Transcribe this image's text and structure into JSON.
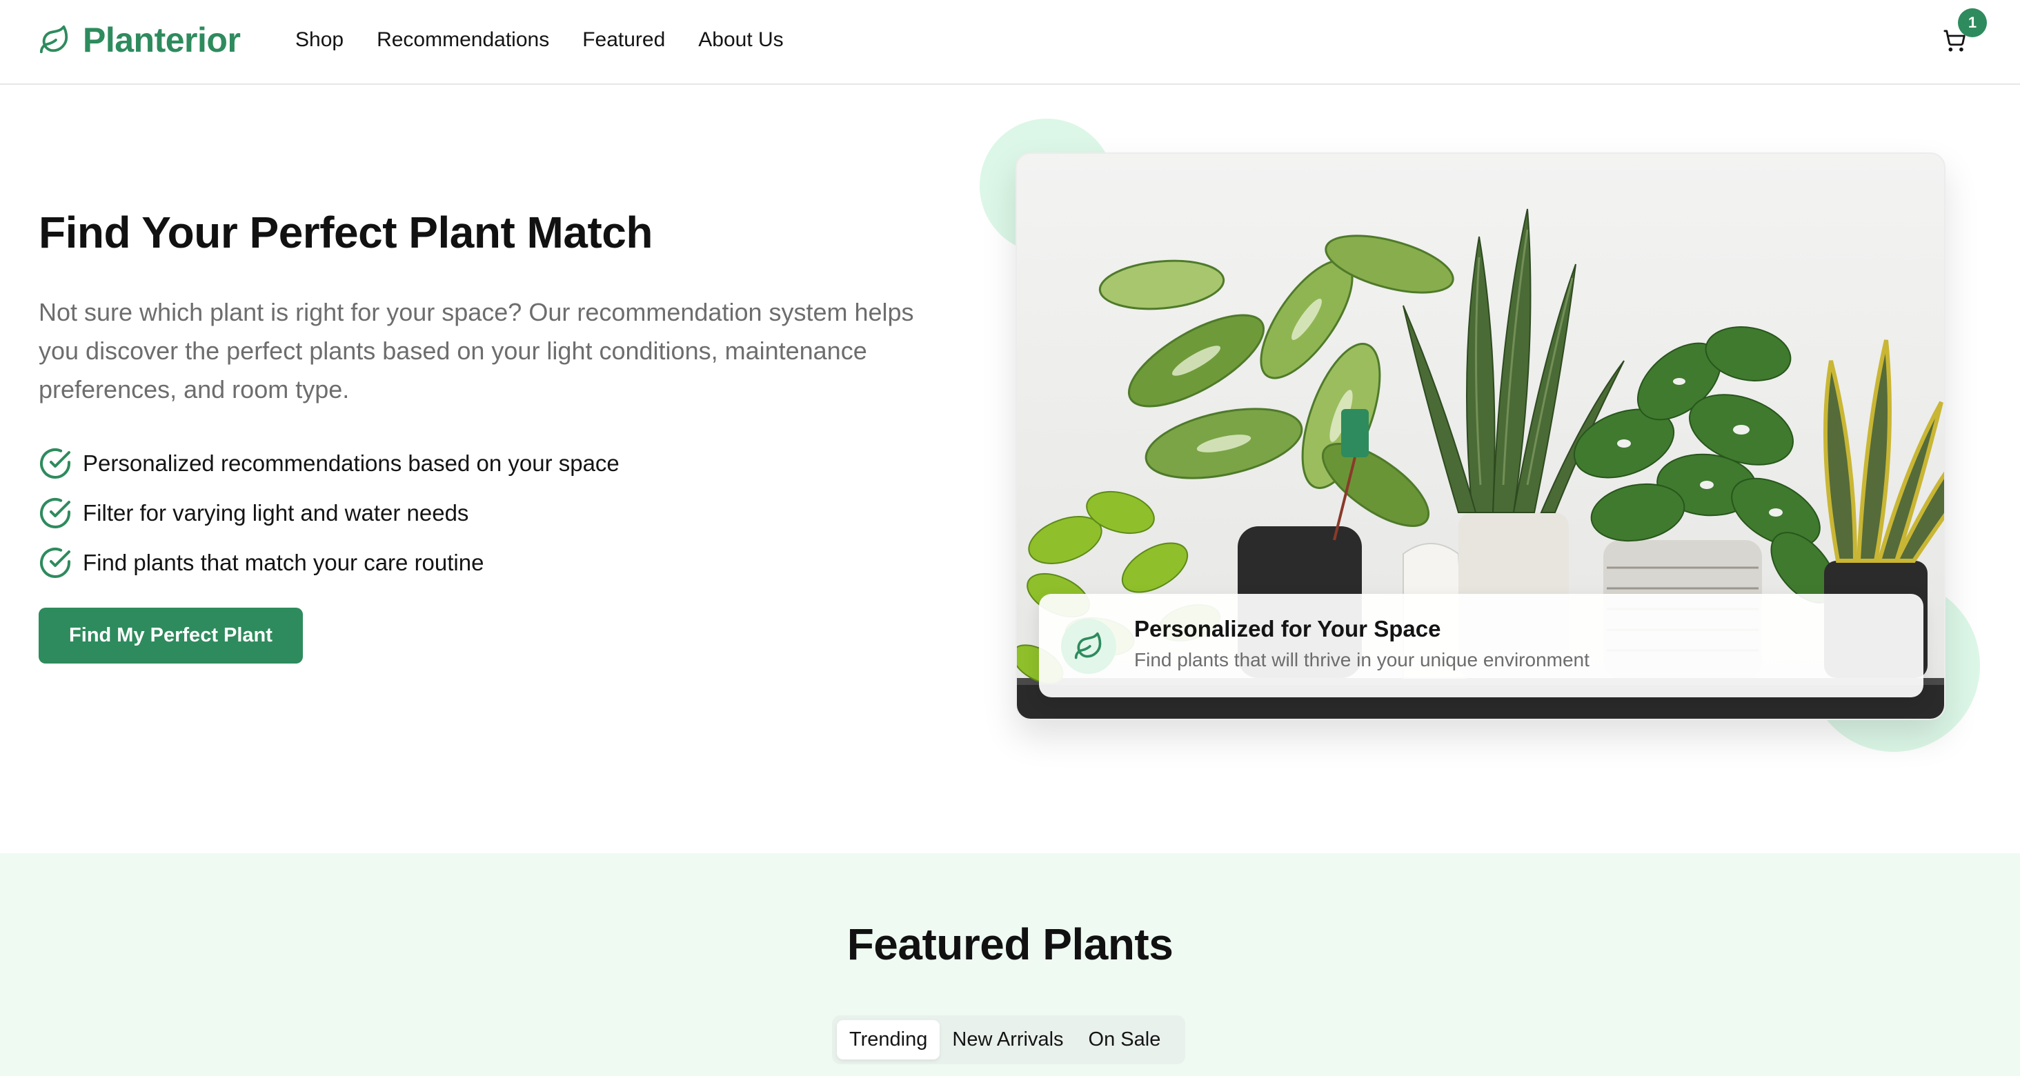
{
  "brand": {
    "name": "Planterior",
    "accent_color": "#2e8b5d",
    "icon": "leaf-icon"
  },
  "nav": {
    "items": [
      {
        "label": "Shop"
      },
      {
        "label": "Recommendations"
      },
      {
        "label": "Featured"
      },
      {
        "label": "About Us"
      }
    ]
  },
  "cart": {
    "icon": "cart-icon",
    "count": "1"
  },
  "hero": {
    "title": "Find Your Perfect Plant Match",
    "description": "Not sure which plant is right for your space? Our recommendation system helps you discover the perfect plants based on your light conditions, maintenance preferences, and room type.",
    "features": [
      {
        "icon": "check-circle-icon",
        "text": "Personalized recommendations based on your space"
      },
      {
        "icon": "check-circle-icon",
        "text": "Filter for varying light and water needs"
      },
      {
        "icon": "check-circle-icon",
        "text": "Find plants that match your care routine"
      }
    ],
    "cta_label": "Find My Perfect Plant"
  },
  "hero_image": {
    "overlay_icon": "leaf-icon",
    "overlay_title": "Personalized for Your Space",
    "overlay_subtitle": "Find plants that will thrive in your unique environment"
  },
  "featured": {
    "title": "Featured Plants",
    "background_color": "#effaf3",
    "tabs": [
      {
        "label": "Trending",
        "active": true
      },
      {
        "label": "New Arrivals",
        "active": false
      },
      {
        "label": "On Sale",
        "active": false
      }
    ]
  }
}
